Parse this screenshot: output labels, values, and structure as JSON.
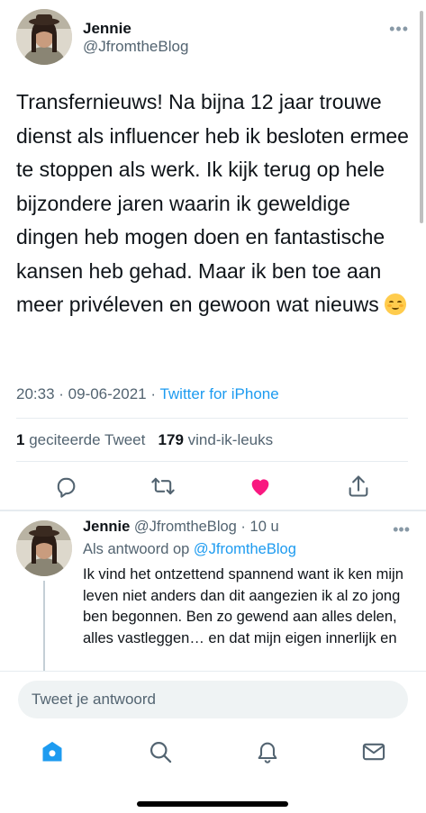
{
  "tweet": {
    "author_name": "Jennie",
    "author_handle": "@JfromtheBlog",
    "text": "Transfernieuws! Na bijna 12 jaar trouwe dienst als influencer heb ik besloten ermee te stoppen als werk. Ik kijk terug op hele bijzondere jaren waarin ik geweldige dingen heb mogen doen en fantastische kansen heb gehad. Maar ik ben toe aan meer privéleven en gewoon wat nieuws",
    "emoji_icon": "relieved-face-emoji",
    "time": "20:33",
    "date": "09-06-2021",
    "source": "Twitter for iPhone",
    "quote_count": "1",
    "quote_label": "geciteerde Tweet",
    "like_count": "179",
    "like_label": "vind-ik-leuks",
    "liked": true,
    "like_color": "#f91880"
  },
  "reply": {
    "author_name": "Jennie",
    "author_handle": "@JfromtheBlog",
    "age": "10 u",
    "replying_prefix": "Als antwoord op",
    "replying_to": "@JfromtheBlog",
    "text": "Ik vind het ontzettend spannend want ik ken mijn leven niet anders dan dit aangezien ik al zo jong ben begonnen. Ben zo gewend aan alles delen, alles vastleggen… en dat mijn eigen innerlijk en"
  },
  "composer": {
    "placeholder": "Tweet je antwoord"
  },
  "tabs": [
    "home-icon",
    "search-icon",
    "notifications-icon",
    "messages-icon"
  ],
  "colors": {
    "accent": "#1d9bf0",
    "muted": "#536471"
  }
}
